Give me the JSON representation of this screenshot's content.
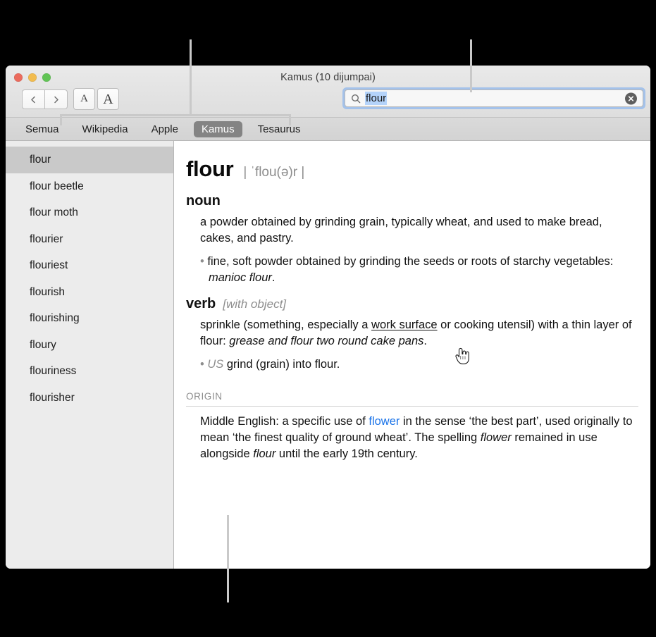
{
  "window": {
    "title": "Kamus (10 dijumpai)",
    "traffic_lights": [
      {
        "name": "close",
        "color": "#eb6b5d"
      },
      {
        "name": "minimize",
        "color": "#f2bc4f"
      },
      {
        "name": "zoom",
        "color": "#61c455"
      }
    ]
  },
  "toolbar": {
    "back_icon": "chevron-left-icon",
    "forward_icon": "chevron-right-icon",
    "font_smaller_label": "A",
    "font_larger_label": "A"
  },
  "search": {
    "icon": "search-icon",
    "value": "flour",
    "placeholder": "Search",
    "clear_icon": "clear-circle-icon",
    "focused": true,
    "selection_color": "#b4d3fa",
    "focus_ring_color": "#a4c2ea"
  },
  "tabs": [
    {
      "label": "Semua",
      "active": false
    },
    {
      "label": "Wikipedia",
      "active": false
    },
    {
      "label": "Apple",
      "active": false
    },
    {
      "label": "Kamus",
      "active": true
    },
    {
      "label": "Tesaurus",
      "active": false
    }
  ],
  "sidebar": {
    "items": [
      {
        "label": "flour",
        "selected": true
      },
      {
        "label": "flour beetle",
        "selected": false
      },
      {
        "label": "flour moth",
        "selected": false
      },
      {
        "label": "flourier",
        "selected": false
      },
      {
        "label": "flouriest",
        "selected": false
      },
      {
        "label": "flourish",
        "selected": false
      },
      {
        "label": "flourishing",
        "selected": false
      },
      {
        "label": "floury",
        "selected": false
      },
      {
        "label": "flouriness",
        "selected": false
      },
      {
        "label": "flourisher",
        "selected": false
      }
    ]
  },
  "entry": {
    "headword": "flour",
    "pronunciation": "| ˈflou(ə)r |",
    "noun": {
      "label": "noun",
      "sense1": "a powder obtained by grinding grain, typically wheat, and used to make bread, cakes, and pastry.",
      "subsense1_bullet": "•",
      "subsense1_text": "fine, soft powder obtained by grinding the seeds or roots of starchy vegetables: ",
      "subsense1_example": "manioc flour",
      "subsense1_tail": "."
    },
    "verb": {
      "label": "verb",
      "grammar_note": "[with object]",
      "sense1_pre": "sprinkle (something, especially a ",
      "sense1_link": "work surface",
      "sense1_mid": " or cooking utensil) with a thin layer of flour: ",
      "sense1_example": "grease and flour two round cake pans",
      "sense1_tail": ".",
      "subsense1_bullet": "•",
      "subsense1_region": "US",
      "subsense1_text": " grind (grain) into flour."
    },
    "origin": {
      "label": "ORIGIN",
      "text_pre": "Middle English: a specific use of ",
      "link": "flower",
      "text_mid": " in the sense ‘the best part’, used originally to mean ‘the finest quality of ground wheat’. The spelling ",
      "italic1": "flower",
      "text_mid2": " remained in use alongside ",
      "italic2": "flour",
      "text_tail": " until the early 19th century."
    }
  },
  "cursor": {
    "type": "pointing-hand-cursor"
  },
  "callouts": {
    "line_color": "#c9c9c9",
    "items": [
      {
        "name": "callout-to-tabs",
        "target": "tab-strip"
      },
      {
        "name": "callout-to-search",
        "target": "search-field"
      },
      {
        "name": "callout-to-content",
        "target": "definition-pane"
      }
    ]
  }
}
